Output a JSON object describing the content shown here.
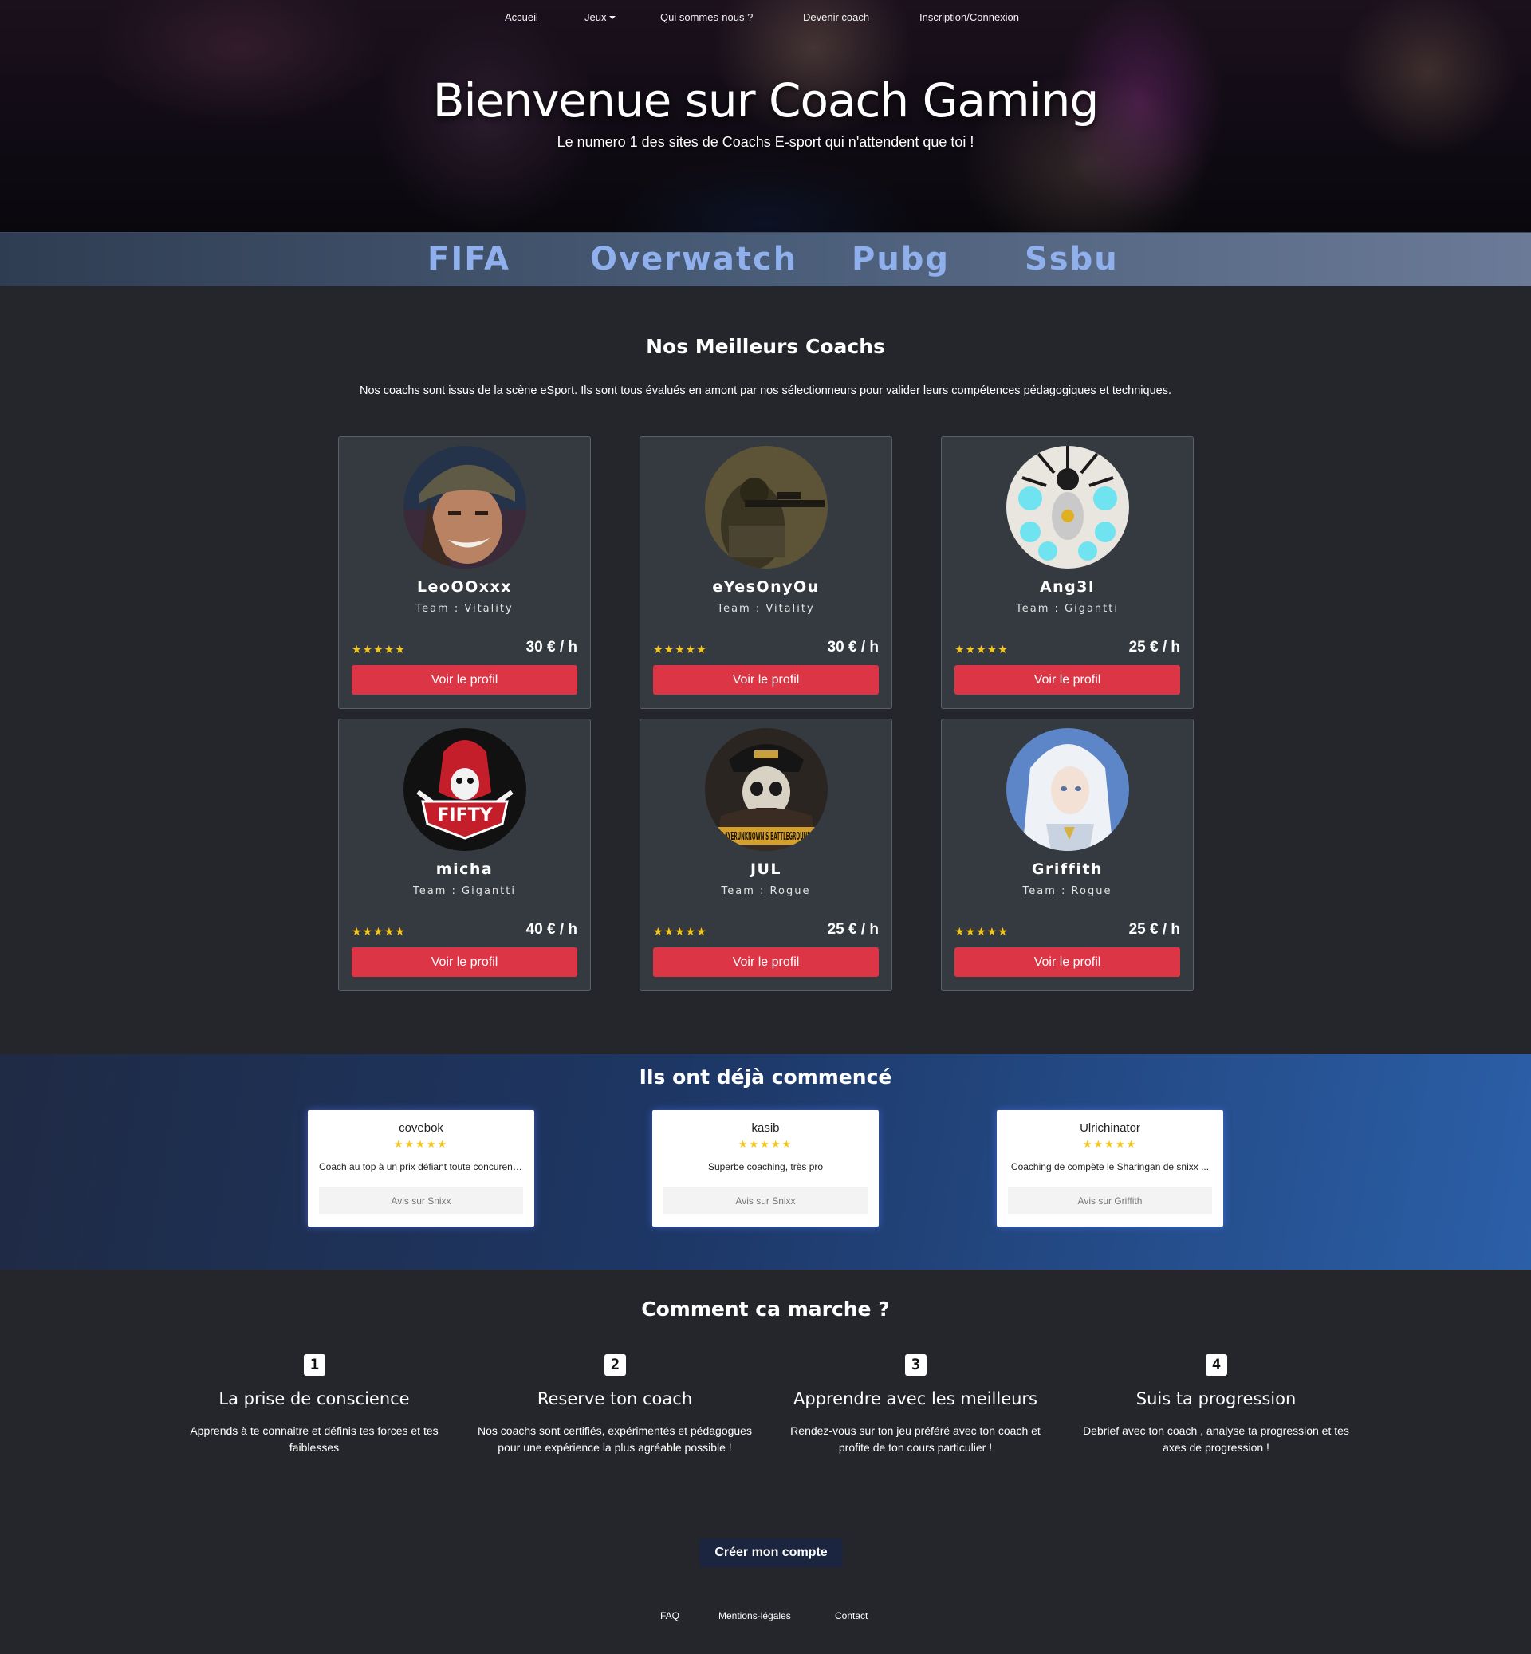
{
  "nav": {
    "items": [
      "Accueil",
      "Jeux",
      "Qui sommes-nous ?",
      "Devenir coach",
      "Inscription/Connexion"
    ]
  },
  "hero": {
    "title": "Bienvenue sur Coach Gaming",
    "subtitle": "Le numero 1 des sites de Coachs E-sport qui n'attendent que toi !"
  },
  "games": [
    "FIFA",
    "Overwatch",
    "Pubg",
    "Ssbu"
  ],
  "coachs": {
    "title": "Nos Meilleurs Coachs",
    "intro": "Nos coachs sont issus de la scène eSport. Ils sont tous évalués en amont par nos sélectionneurs pour valider leurs compétences pédagogiques et techniques.",
    "team_prefix": "Team :",
    "button_label": "Voir le profil",
    "items": [
      {
        "name": "LeoOOxxx",
        "team": "Vitality",
        "stars": "★★★★★",
        "price": "30 € / h"
      },
      {
        "name": "eYesOnyOu",
        "team": "Vitality",
        "stars": "★★★★★",
        "price": "30 € / h"
      },
      {
        "name": "Ang3l",
        "team": "Gigantti",
        "stars": "★★★★★",
        "price": "25 € / h"
      },
      {
        "name": "micha",
        "team": "Gigantti",
        "stars": "★★★★★",
        "price": "40 € / h",
        "avatar_text": "FIFTY"
      },
      {
        "name": "JUL",
        "team": "Rogue",
        "stars": "★★★★★",
        "price": "25 € / h",
        "avatar_text": "PLAYERUNKNOWN'S BATTLEGROUNDS"
      },
      {
        "name": "Griffith",
        "team": "Rogue",
        "stars": "★★★★★",
        "price": "25 € / h"
      }
    ]
  },
  "testimonials": {
    "title": "Ils ont déjà commencé",
    "items": [
      {
        "name": "covebok",
        "stars": "★★★★★",
        "text": "Coach au top à un prix défiant toute concurence...",
        "footer": "Avis sur Snixx"
      },
      {
        "name": "kasib",
        "stars": "★★★★★",
        "text": "Superbe coaching, très pro",
        "footer": "Avis sur Snixx"
      },
      {
        "name": "Ulrichinator",
        "stars": "★★★★★",
        "text": "Coaching de compète le Sharingan de snixx ...",
        "footer": "Avis sur Griffith"
      }
    ]
  },
  "how": {
    "title": "Comment ca marche ?",
    "steps": [
      {
        "num": "1",
        "title": "La prise de conscience",
        "text": "Apprends à te connaitre et définis tes forces et tes faiblesses"
      },
      {
        "num": "2",
        "title": "Reserve ton coach",
        "text": "Nos coachs sont certifiés, expérimentés et pédagogues pour une expérience la plus agréable possible !"
      },
      {
        "num": "3",
        "title": "Apprendre avec les meilleurs",
        "text": "Rendez-vous sur ton jeu préféré avec ton coach et profite de ton cours particulier !"
      },
      {
        "num": "4",
        "title": "Suis ta progression",
        "text": "Debrief avec ton coach , analyse ta progression et tes axes de progression !"
      }
    ]
  },
  "cta": {
    "label": "Créer mon compte"
  },
  "footer": {
    "links": [
      "FAQ",
      "Mentions-légales",
      "Contact"
    ]
  },
  "colors": {
    "accent": "#dc3545",
    "star": "#f5c518",
    "game_text": "#8fb0ec",
    "background": "#25262b"
  }
}
